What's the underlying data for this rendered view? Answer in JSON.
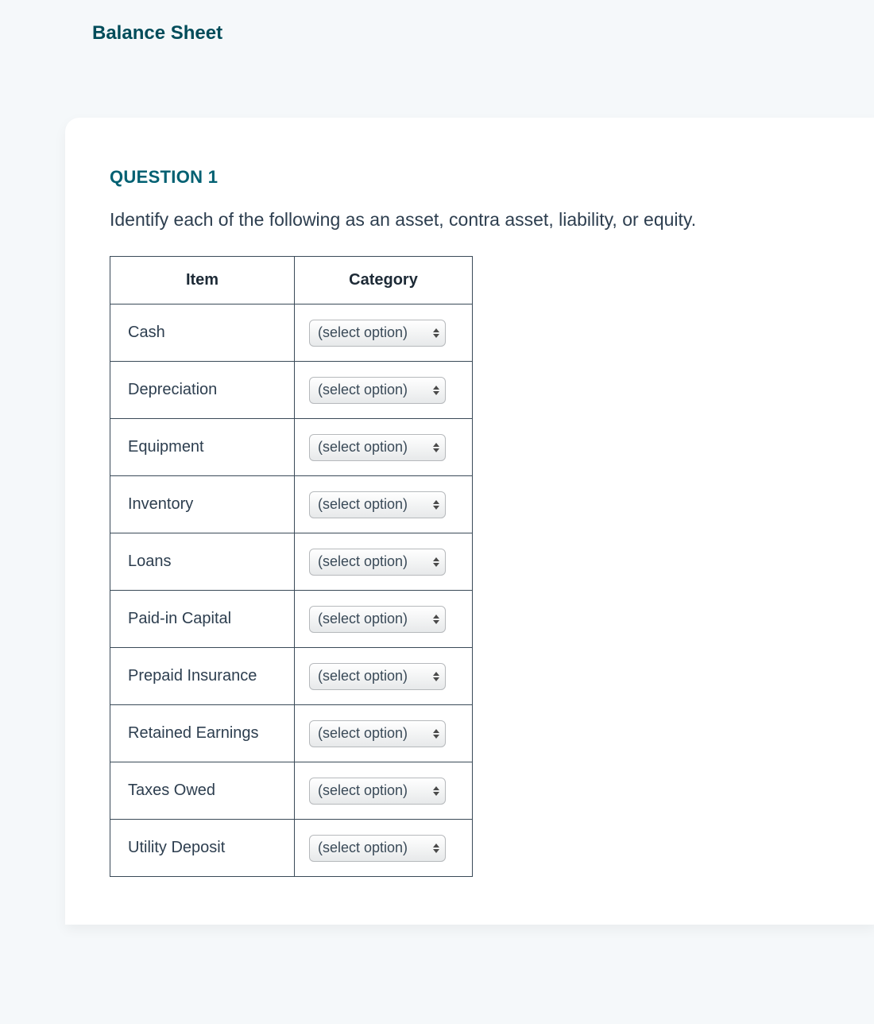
{
  "header": {
    "title": "Balance Sheet"
  },
  "question": {
    "label": "QUESTION 1",
    "prompt": "Identify each of the following as an asset, contra asset, liability, or equity."
  },
  "table": {
    "headers": {
      "item": "Item",
      "category": "Category"
    },
    "rows": [
      {
        "item": "Cash",
        "category": "(select option)"
      },
      {
        "item": "Depreciation",
        "category": "(select option)"
      },
      {
        "item": "Equipment",
        "category": "(select option)"
      },
      {
        "item": "Inventory",
        "category": "(select option)"
      },
      {
        "item": "Loans",
        "category": "(select option)"
      },
      {
        "item": "Paid-in Capital",
        "category": "(select option)"
      },
      {
        "item": "Prepaid Insurance",
        "category": "(select option)"
      },
      {
        "item": "Retained Earnings",
        "category": "(select option)"
      },
      {
        "item": "Taxes Owed",
        "category": "(select option)"
      },
      {
        "item": "Utility Deposit",
        "category": "(select option)"
      }
    ]
  }
}
